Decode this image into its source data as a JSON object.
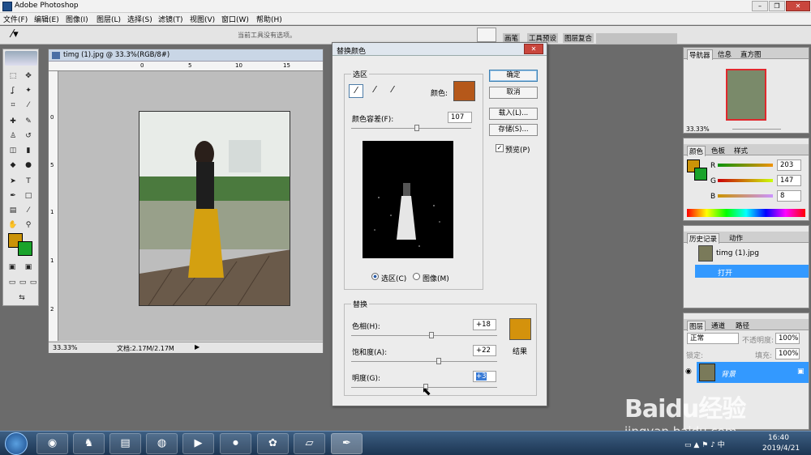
{
  "app": {
    "title": "Adobe Photoshop"
  },
  "menu": [
    "文件(F)",
    "编辑(E)",
    "图像(I)",
    "图层(L)",
    "选择(S)",
    "滤镜(T)",
    "视图(V)",
    "窗口(W)",
    "帮助(H)"
  ],
  "options_bar": {
    "message": "当前工具没有选项。",
    "dock_tabs": [
      "画笔",
      "工具预设",
      "图层复合"
    ]
  },
  "document": {
    "title": "timg (1).jpg @ 33.3%(RGB/8#)",
    "zoom": "33.33%",
    "doc_info": "文档:2.17M/2.17M",
    "ruler_h": [
      "0",
      "5",
      "10",
      "15"
    ],
    "ruler_v": [
      "0",
      "5",
      "1",
      "1",
      "2"
    ]
  },
  "dialog": {
    "title": "替换颜色",
    "selection_group": "选区",
    "color_label": "颜色:",
    "selection_color": "#b5581a",
    "fuzziness_label": "颜色容差(F):",
    "fuzziness_value": "107",
    "fuzziness_level": 0.55,
    "radio_selection": "选区(C)",
    "radio_image": "图像(M)",
    "replace_group": "替换",
    "hue_label": "色相(H):",
    "hue_value": "+18",
    "hue_level": 0.55,
    "saturation_label": "饱和度(A):",
    "saturation_value": "+22",
    "saturation_level": 0.6,
    "lightness_label": "明度(G):",
    "lightness_value": "+3",
    "lightness_level": 0.51,
    "result_label": "结果",
    "result_color": "#d4920c",
    "buttons": {
      "ok": "确定",
      "cancel": "取消",
      "load": "载入(L)...",
      "save": "存储(S)..."
    },
    "preview_label": "预览(P)"
  },
  "panels": {
    "navigator": {
      "tabs": [
        "导航器",
        "信息",
        "直方图"
      ],
      "zoom": "33.33%"
    },
    "color": {
      "tabs": [
        "颜色",
        "色板",
        "样式"
      ],
      "r_label": "R",
      "g_label": "G",
      "b_label": "B",
      "r": "203",
      "g": "147",
      "b": "8",
      "fg_color": "#cb9308"
    },
    "history": {
      "tabs": [
        "历史记录",
        "动作"
      ],
      "snapshot": "timg (1).jpg",
      "step": "打开"
    },
    "layers": {
      "tabs": [
        "图层",
        "通道",
        "路径"
      ],
      "blend_mode": "正常",
      "opacity_label": "不透明度:",
      "opacity": "100%",
      "lock_label": "锁定:",
      "fill_label": "填充:",
      "fill": "100%",
      "layer_name": "背景"
    }
  },
  "taskbar": {
    "time": "16:40",
    "date": "2019/4/21"
  },
  "watermark": {
    "brand": "Baidu经验",
    "url": "jingyan.baidu.com"
  }
}
